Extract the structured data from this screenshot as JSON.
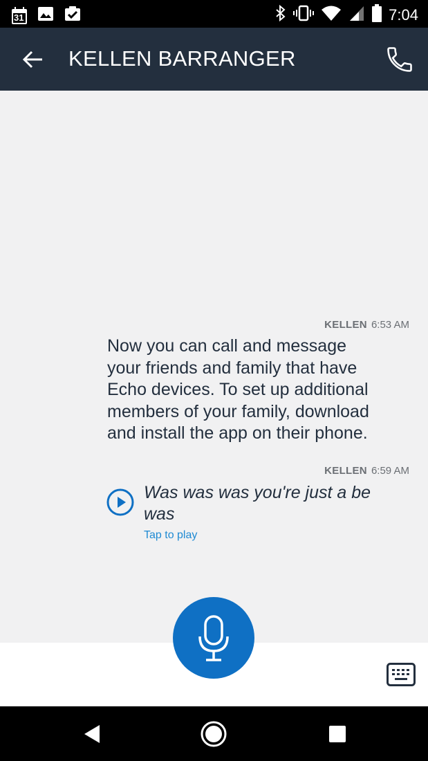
{
  "status_bar": {
    "time": "7:04",
    "calendar_date": "31",
    "icons": [
      "calendar-icon",
      "image-icon",
      "clipboard-check-icon",
      "bluetooth-icon",
      "vibrate-icon",
      "wifi-icon",
      "signal-icon",
      "battery-icon"
    ]
  },
  "header": {
    "title": "KELLEN BARRANGER"
  },
  "messages": [
    {
      "sender": "KELLEN",
      "time": "6:53 AM",
      "lines": [
        "Now you can call and message",
        "your friends and family that have",
        "Echo devices. To set up additional",
        "members of your family, download",
        "and install the app on their phone."
      ]
    },
    {
      "sender": "KELLEN",
      "time": "6:59 AM",
      "voice_lines": [
        "Was was was you're just a be",
        "was"
      ],
      "action": "Tap to play"
    }
  ],
  "colors": {
    "header_bg": "#232f3e",
    "accent": "#0f70c4",
    "link": "#1f8ad3",
    "chat_bg": "#f1f1f2"
  }
}
